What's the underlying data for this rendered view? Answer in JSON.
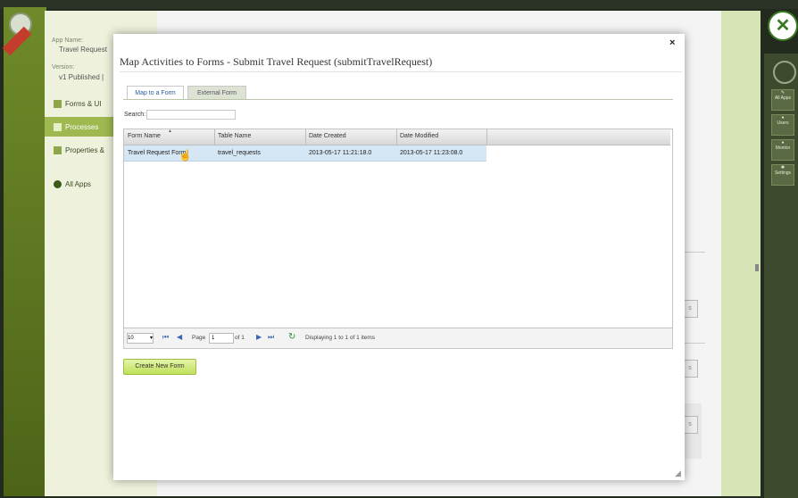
{
  "app": {
    "sidebar": {
      "app_name_label": "App Name:",
      "app_name_value": "Travel Request",
      "version_label": "Version:",
      "version_value": "v1 Published |",
      "items": [
        {
          "label": "Forms & UI"
        },
        {
          "label": "Processes"
        },
        {
          "label": "Properties &"
        }
      ],
      "all_apps": "All Apps"
    },
    "right_toolbar": {
      "buttons": [
        {
          "label": "All Apps",
          "icon": "wrench-icon"
        },
        {
          "label": "Users",
          "icon": "user-icon"
        },
        {
          "label": "Monitor",
          "icon": "monitor-icon"
        },
        {
          "label": "Settings",
          "icon": "settings-icon"
        }
      ]
    },
    "main_buttons": [
      "s",
      "s",
      "s"
    ]
  },
  "modal": {
    "title": "Map Activities to Forms - Submit Travel Request (submitTravelRequest)",
    "close_glyph": "×",
    "tabs": [
      {
        "label": "Map to a Form",
        "active": true
      },
      {
        "label": "External Form",
        "active": false
      }
    ],
    "search": {
      "label": "Search:",
      "value": ""
    },
    "grid": {
      "columns": [
        "Form Name",
        "Table Name",
        "Date Created",
        "Date Modified"
      ],
      "rows": [
        {
          "form_name": "Travel Request Form",
          "table_name": "travel_requests",
          "date_created": "2013-05-17 11:21:18.0",
          "date_modified": "2013-05-17 11:23:08.0"
        }
      ]
    },
    "pager": {
      "page_size": "10",
      "page_label": "Page",
      "page_value": "1",
      "of_label": "of 1",
      "display_text": "Displaying 1 to 1 of 1 items"
    },
    "create_button": "Create New Form"
  },
  "colors": {
    "accent_green": "#bfe05a",
    "selected_row": "#d5e6f4",
    "link_blue": "#2a5a9a"
  }
}
